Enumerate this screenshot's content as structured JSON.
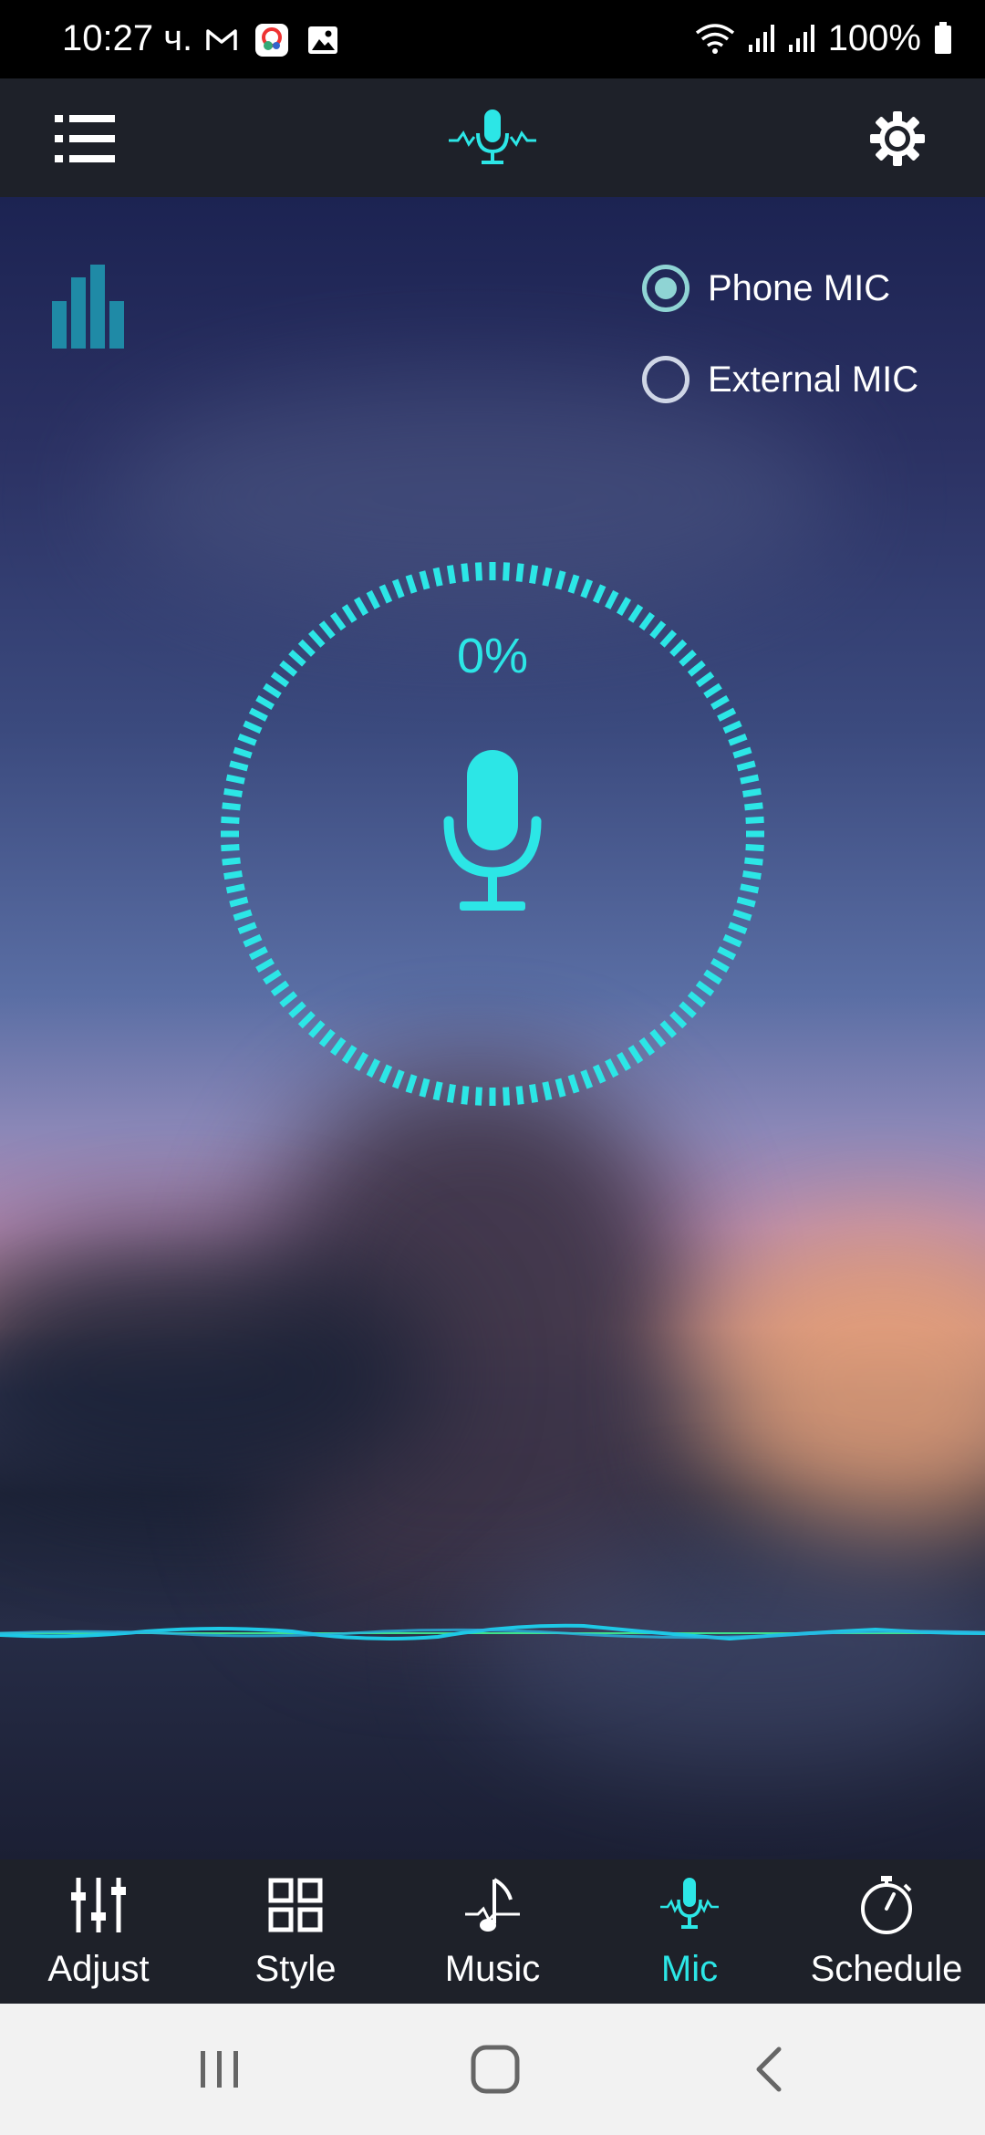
{
  "status_bar": {
    "time": "10:27 ч.",
    "battery_percent": "100%",
    "notification_icons": [
      "gmail-icon",
      "app-notification-icon",
      "gallery-icon"
    ],
    "system_icons": [
      "wifi-icon",
      "signal-icon",
      "signal-icon",
      "battery-icon"
    ]
  },
  "app_bar": {
    "menu_icon": "menu-list-icon",
    "logo_icon": "mic-wave-icon",
    "settings_icon": "gear-icon"
  },
  "main": {
    "equalizer_icon": "equalizer-icon",
    "mic_source": {
      "options": [
        {
          "label": "Phone MIC",
          "selected": true
        },
        {
          "label": "External MIC",
          "selected": false
        }
      ]
    },
    "level_percent": "0%",
    "mic_icon": "microphone-icon"
  },
  "bottom_nav": {
    "items": [
      {
        "label": "Adjust",
        "icon": "sliders-icon",
        "active": false
      },
      {
        "label": "Style",
        "icon": "grid-icon",
        "active": false
      },
      {
        "label": "Music",
        "icon": "music-note-icon",
        "active": false
      },
      {
        "label": "Mic",
        "icon": "mic-wave-icon",
        "active": true
      },
      {
        "label": "Schedule",
        "icon": "stopwatch-icon",
        "active": false
      }
    ]
  },
  "system_nav": {
    "buttons": [
      "recents-icon",
      "home-icon",
      "back-icon"
    ]
  },
  "colors": {
    "accent": "#2ce6e6",
    "bar_bg": "#1e2129",
    "status_bg": "#000000",
    "system_nav_bg": "#f2f2f2"
  }
}
